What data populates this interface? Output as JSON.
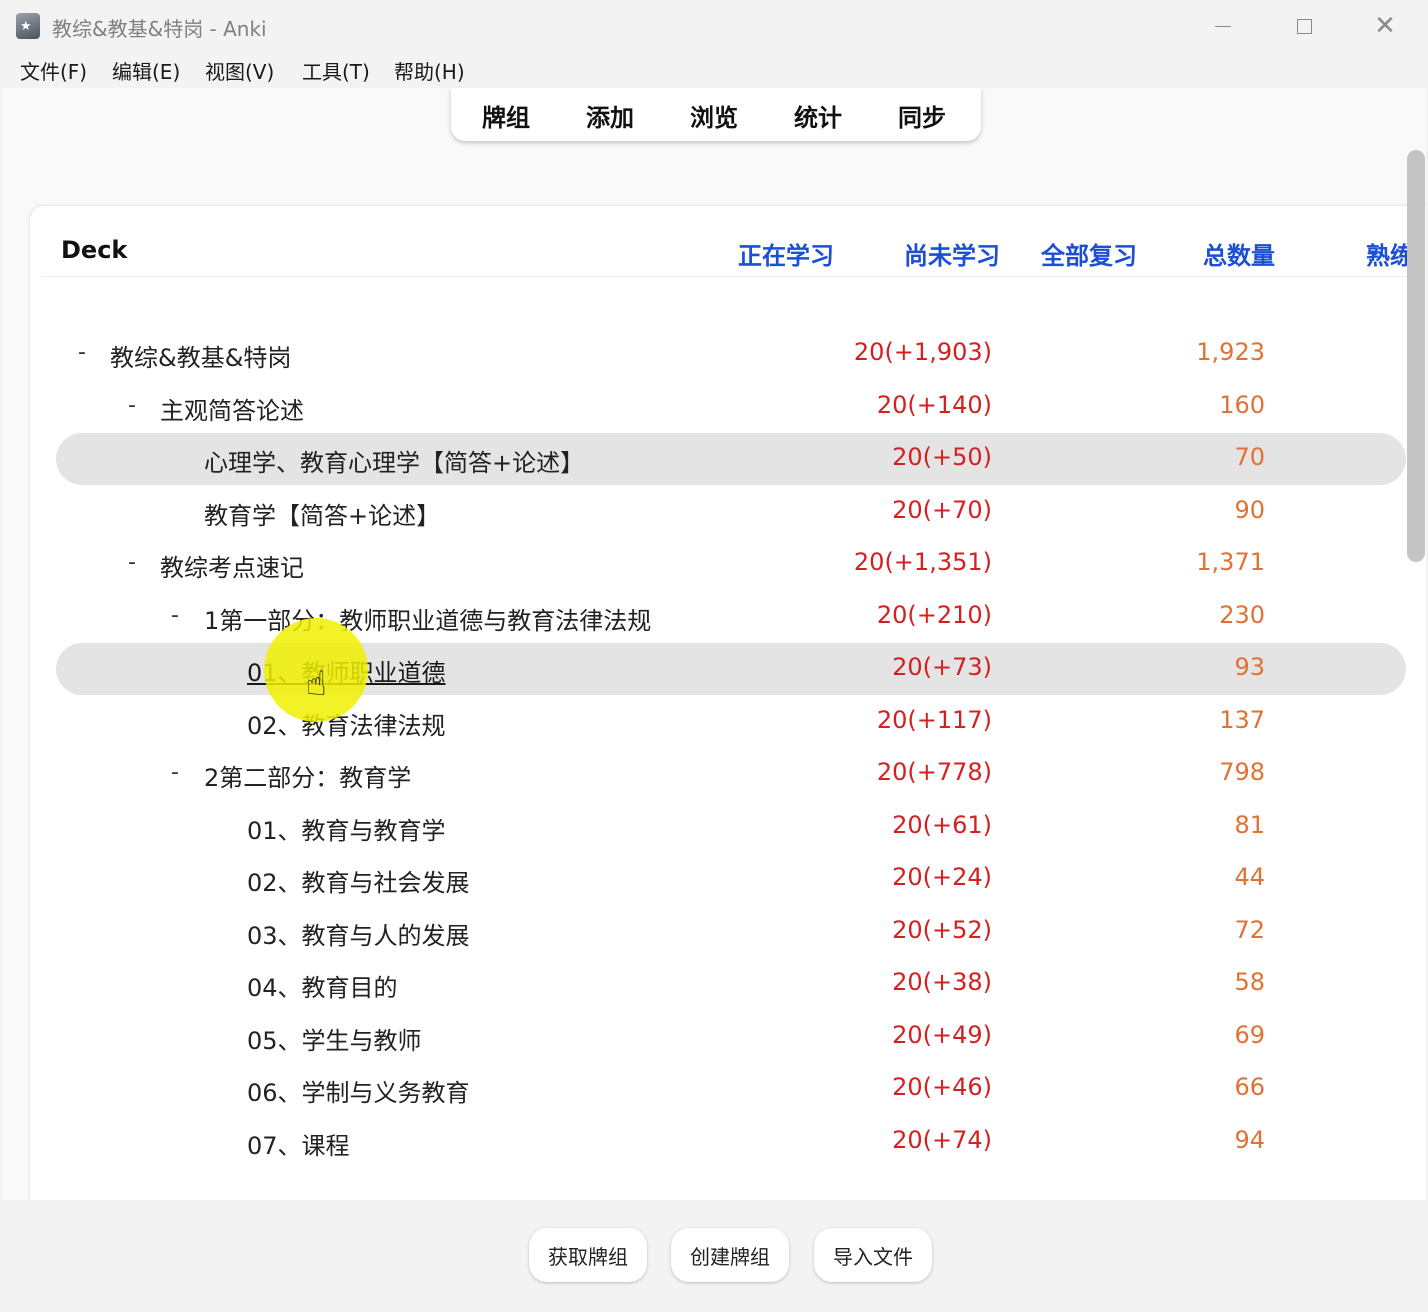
{
  "window": {
    "title": "教综&教基&特岗 - Anki"
  },
  "menu": [
    "文件(F)",
    "编辑(E)",
    "视图(V)",
    "工具(T)",
    "帮助(H)"
  ],
  "toolbar": [
    "牌组",
    "添加",
    "浏览",
    "统计",
    "同步"
  ],
  "table": {
    "deck_header": "Deck",
    "columns": [
      "正在学习",
      "尚未学习",
      "全部复习",
      "总数量",
      "熟练"
    ],
    "rows": [
      {
        "name": "教综&教基&特岗",
        "collapse": "-",
        "new": "20(+1,903)",
        "total": "1,923"
      },
      {
        "name": "主观简答论述",
        "collapse": "-",
        "new": "20(+140)",
        "total": "160"
      },
      {
        "name": "心理学、教育心理学【简答+论述】",
        "collapse": "",
        "new": "20(+50)",
        "total": "70"
      },
      {
        "name": "教育学【简答+论述】",
        "collapse": "",
        "new": "20(+70)",
        "total": "90"
      },
      {
        "name": "教综考点速记",
        "collapse": "-",
        "new": "20(+1,351)",
        "total": "1,371"
      },
      {
        "name": "1第一部分：教师职业道德与教育法律法规",
        "collapse": "-",
        "new": "20(+210)",
        "total": "230"
      },
      {
        "name": "01、教师职业道德",
        "collapse": "",
        "new": "20(+73)",
        "total": "93"
      },
      {
        "name": "02、教育法律法规",
        "collapse": "",
        "new": "20(+117)",
        "total": "137"
      },
      {
        "name": "2第二部分：教育学",
        "collapse": "-",
        "new": "20(+778)",
        "total": "798"
      },
      {
        "name": "01、教育与教育学",
        "collapse": "",
        "new": "20(+61)",
        "total": "81"
      },
      {
        "name": "02、教育与社会发展",
        "collapse": "",
        "new": "20(+24)",
        "total": "44"
      },
      {
        "name": "03、教育与人的发展",
        "collapse": "",
        "new": "20(+52)",
        "total": "72"
      },
      {
        "name": "04、教育目的",
        "collapse": "",
        "new": "20(+38)",
        "total": "58"
      },
      {
        "name": "05、学生与教师",
        "collapse": "",
        "new": "20(+49)",
        "total": "69"
      },
      {
        "name": "06、学制与义务教育",
        "collapse": "",
        "new": "20(+46)",
        "total": "66"
      },
      {
        "name": "07、课程",
        "collapse": "",
        "new": "20(+74)",
        "total": "94"
      }
    ]
  },
  "bottom_buttons": [
    "获取牌组",
    "创建牌组",
    "导入文件"
  ],
  "colors": {
    "header_blue": "#1b4fd6",
    "new_red": "#d42020",
    "total_orange": "#e07233"
  }
}
